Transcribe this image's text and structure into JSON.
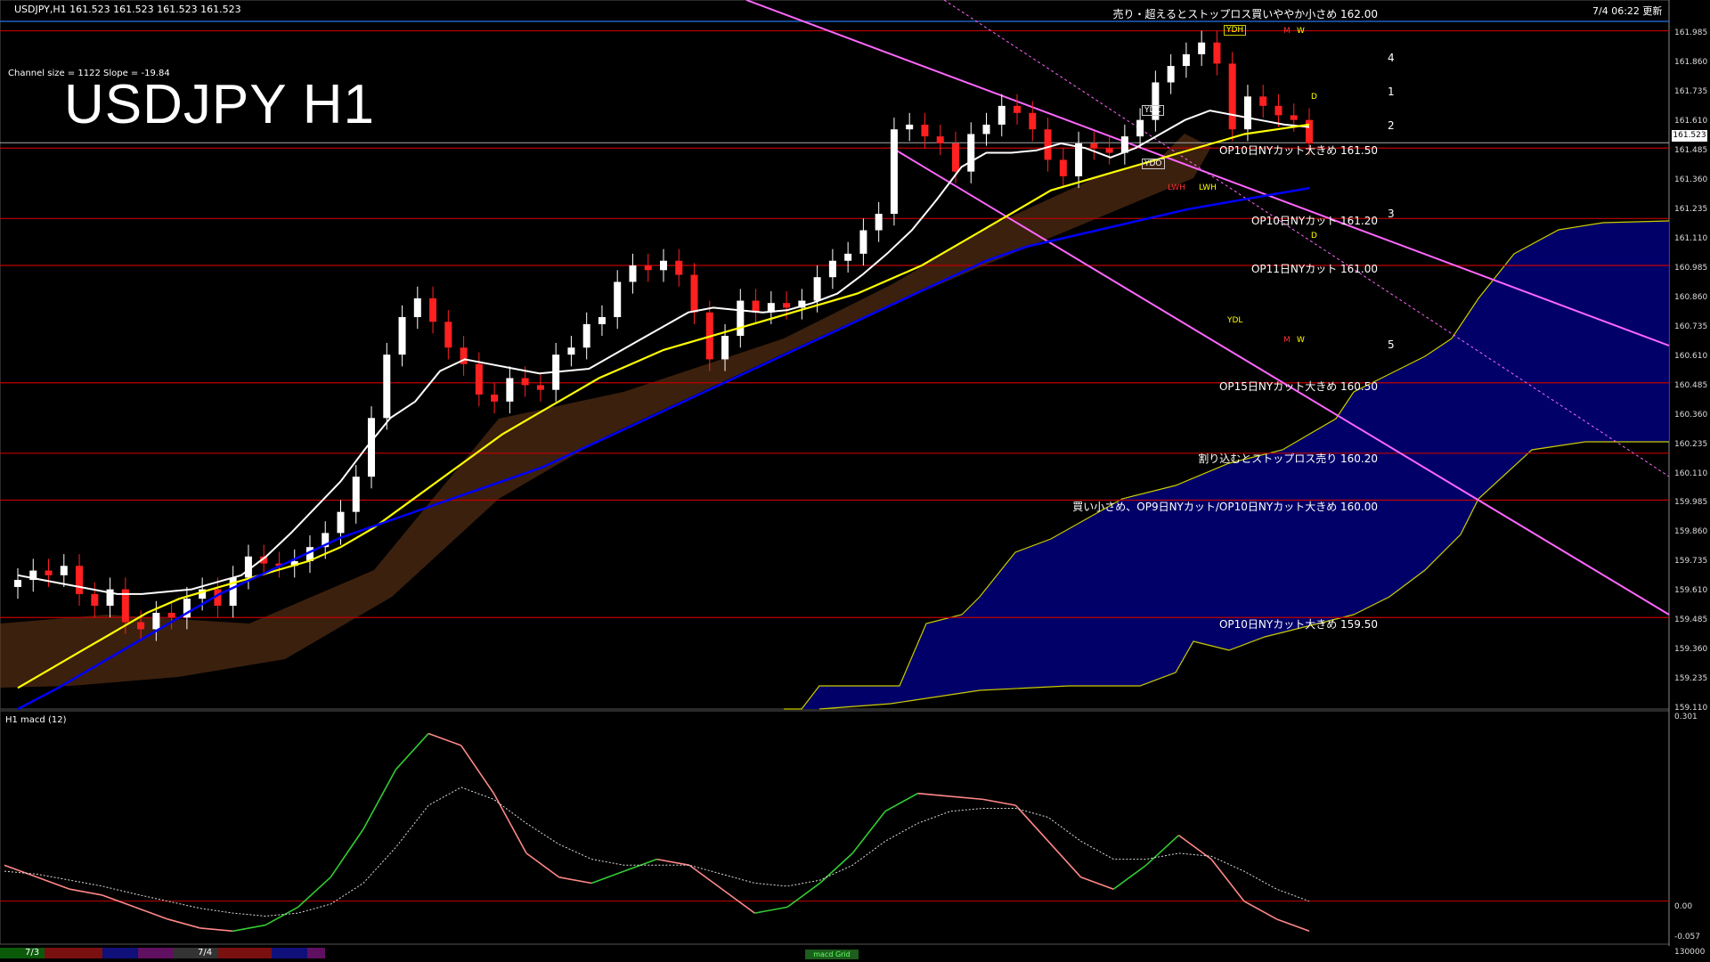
{
  "header": {
    "symbol_info": "USDJPY,H1  161.523 161.523 161.523 161.523",
    "datetime": "7/4 06:22 更新"
  },
  "title": "USDJPY H1",
  "channel_info": "Channel size = 1122 Slope = -19.84",
  "macd_label": "H1  macd (12)",
  "current_price": "161.523",
  "price_axis": [
    "161.985",
    "161.860",
    "161.735",
    "161.610",
    "161.485",
    "161.360",
    "161.235",
    "161.110",
    "160.985",
    "160.860",
    "160.735",
    "160.610",
    "160.485",
    "160.360",
    "160.235",
    "160.110",
    "159.985",
    "159.860",
    "159.735",
    "159.610",
    "159.485",
    "159.360",
    "159.235",
    "159.110"
  ],
  "macd_axis": [
    "0.301",
    "0.00",
    "-0.057",
    "130000"
  ],
  "annotations": [
    {
      "text": "売り・超えるとストップロス買いややか小さめ 162.00",
      "price": 162.0
    },
    {
      "text": "OP10日NYカット大きめ 161.50",
      "price": 161.5
    },
    {
      "text": "OP10日NYカット 161.20",
      "price": 161.2
    },
    {
      "text": "OP11日NYカット 161.00",
      "price": 161.0
    },
    {
      "text": "OP15日NYカット大きめ 160.50",
      "price": 160.5
    },
    {
      "text": "割り込むとストップロス売り 160.20",
      "price": 160.2
    },
    {
      "text": "買い小さめ、OP9日NYカット/OP10日NYカット大きめ 160.00",
      "price": 160.0
    },
    {
      "text": "OP10日NYカット大きめ 159.50",
      "price": 159.5
    }
  ],
  "chart_labels": [
    "YDH",
    "YDL",
    "YDC",
    "YDO",
    "LWH",
    "LWH",
    "M",
    "W",
    "M",
    "W",
    "D",
    "D"
  ],
  "wave_labels": [
    "4",
    "1",
    "2",
    "3",
    "5"
  ],
  "bottom_dates": [
    "7/3",
    "7/4"
  ],
  "macd_tab": "macd Grid",
  "colors": {
    "background": "#000000",
    "level_line": "#cc0000",
    "bull_candle": "#ffffff",
    "bear_candle": "#ff2020",
    "sma_white": "#ffffff",
    "sma_yellow": "#ffff00",
    "sma_blue": "#0000ff",
    "macd_main_up": "#33cc33",
    "macd_main_down": "#ff8888",
    "channel": "#ff66ff",
    "cloud": "#0000aa"
  },
  "chart_data": {
    "type": "line",
    "title": "USDJPY H1",
    "ylim": [
      159.11,
      162.04
    ],
    "close": [
      159.66,
      159.7,
      159.68,
      159.72,
      159.6,
      159.55,
      159.62,
      159.48,
      159.45,
      159.52,
      159.5,
      159.58,
      159.62,
      159.55,
      159.67,
      159.76,
      159.73,
      159.72,
      159.74,
      159.8,
      159.86,
      159.95,
      160.1,
      160.35,
      160.62,
      160.78,
      160.86,
      160.76,
      160.65,
      160.58,
      160.45,
      160.42,
      160.52,
      160.49,
      160.47,
      160.62,
      160.65,
      160.75,
      160.78,
      160.93,
      161.0,
      160.98,
      161.02,
      160.96,
      160.8,
      160.6,
      160.7,
      160.85,
      160.8,
      160.84,
      160.82,
      160.85,
      160.95,
      161.02,
      161.05,
      161.15,
      161.22,
      161.58,
      161.6,
      161.55,
      161.52,
      161.4,
      161.56,
      161.6,
      161.68,
      161.65,
      161.58,
      161.45,
      161.38,
      161.52,
      161.5,
      161.48,
      161.55,
      161.62,
      161.78,
      161.85,
      161.9,
      161.95,
      161.86,
      161.58,
      161.72,
      161.68,
      161.64,
      161.62,
      161.52
    ],
    "sma_white": [
      159.68,
      159.66,
      159.64,
      159.62,
      159.6,
      159.6,
      159.61,
      159.62,
      159.65,
      159.68,
      159.76,
      159.86,
      159.97,
      160.08,
      160.22,
      160.35,
      160.42,
      160.55,
      160.6,
      160.58,
      160.56,
      160.54,
      160.55,
      160.56,
      160.62,
      160.68,
      160.74,
      160.8,
      160.82,
      160.81,
      160.8,
      160.81,
      160.84,
      160.88,
      160.96,
      161.05,
      161.15,
      161.28,
      161.42,
      161.48,
      161.48,
      161.49,
      161.52,
      161.5,
      161.46,
      161.5,
      161.56,
      161.62,
      161.66,
      161.64,
      161.62,
      161.6,
      161.59
    ],
    "sma_yellow": [
      159.2,
      159.28,
      159.36,
      159.44,
      159.52,
      159.58,
      159.62,
      159.66,
      159.7,
      159.74,
      159.8,
      159.88,
      159.98,
      160.08,
      160.18,
      160.28,
      160.36,
      160.44,
      160.52,
      160.58,
      160.64,
      160.68,
      160.72,
      160.76,
      160.8,
      160.84,
      160.88,
      160.94,
      161.0,
      161.08,
      161.16,
      161.24,
      161.32,
      161.36,
      161.4,
      161.44,
      161.48,
      161.52,
      161.56,
      161.58,
      161.6
    ],
    "sma_blue": [
      159.11,
      159.2,
      159.3,
      159.4,
      159.5,
      159.6,
      159.68,
      159.76,
      159.84,
      159.9,
      159.96,
      160.02,
      160.08,
      160.14,
      160.22,
      160.3,
      160.38,
      160.46,
      160.54,
      160.62,
      160.7,
      160.78,
      160.86,
      160.94,
      161.02,
      161.08,
      161.12,
      161.16,
      161.2,
      161.24,
      161.27,
      161.3,
      161.33
    ],
    "macd": [
      0.06,
      0.04,
      0.02,
      0.01,
      -0.01,
      -0.03,
      -0.045,
      -0.05,
      -0.04,
      -0.01,
      0.04,
      0.12,
      0.22,
      0.28,
      0.26,
      0.18,
      0.08,
      0.04,
      0.03,
      0.05,
      0.07,
      0.06,
      0.02,
      -0.02,
      -0.01,
      0.03,
      0.08,
      0.15,
      0.18,
      0.175,
      0.17,
      0.16,
      0.1,
      0.04,
      0.02,
      0.06,
      0.11,
      0.07,
      0.0,
      -0.03,
      -0.05
    ],
    "macd_signal": [
      0.05,
      0.045,
      0.035,
      0.025,
      0.012,
      0.0,
      -0.012,
      -0.02,
      -0.025,
      -0.02,
      -0.005,
      0.03,
      0.09,
      0.16,
      0.19,
      0.17,
      0.13,
      0.095,
      0.07,
      0.06,
      0.06,
      0.06,
      0.045,
      0.03,
      0.025,
      0.035,
      0.06,
      0.1,
      0.13,
      0.15,
      0.155,
      0.155,
      0.14,
      0.1,
      0.07,
      0.07,
      0.08,
      0.075,
      0.05,
      0.02,
      0.0
    ]
  }
}
